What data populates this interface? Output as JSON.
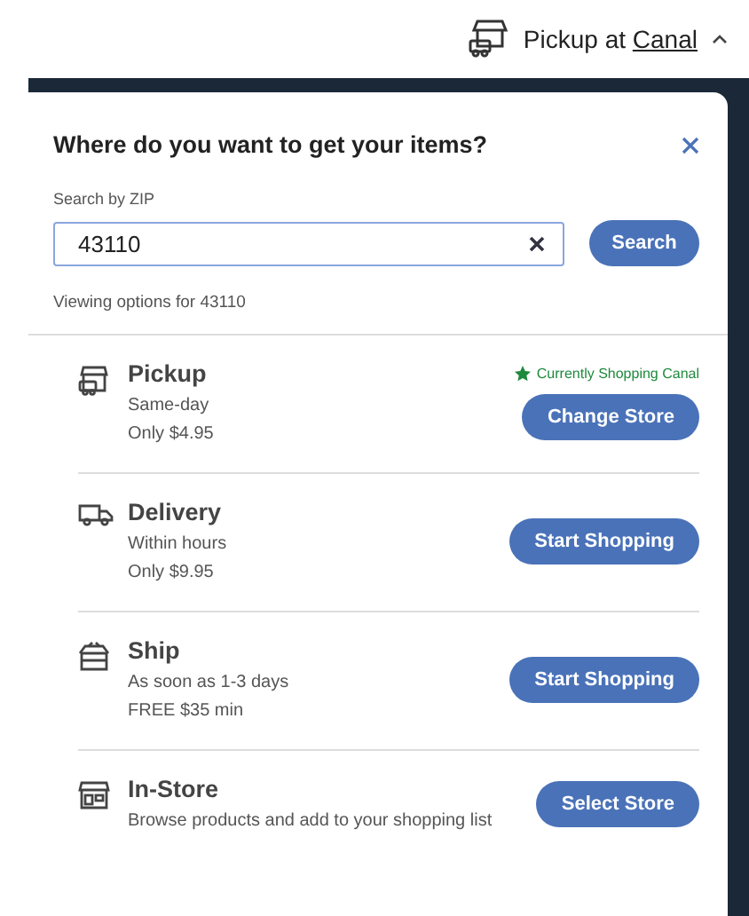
{
  "header": {
    "label": "Pickup at",
    "store": "Canal"
  },
  "panel": {
    "title": "Where do you want to get your items?",
    "search_label": "Search by ZIP",
    "zip": "43110",
    "search_button": "Search",
    "viewing": "Viewing options for 43110"
  },
  "options": [
    {
      "kind": "pickup",
      "title": "Pickup",
      "lines": [
        "Same-day",
        "Only $4.95"
      ],
      "note": "Currently Shopping Canal",
      "button": "Change Store"
    },
    {
      "kind": "delivery",
      "title": "Delivery",
      "lines": [
        "Within hours",
        "Only $9.95"
      ],
      "button": "Start Shopping"
    },
    {
      "kind": "ship",
      "title": "Ship",
      "lines": [
        "As soon as 1-3 days",
        "FREE $35 min"
      ],
      "button": "Start Shopping"
    },
    {
      "kind": "instore",
      "title": "In-Store",
      "lines": [
        "Browse products and add to your shopping list"
      ],
      "button": "Select Store"
    }
  ]
}
